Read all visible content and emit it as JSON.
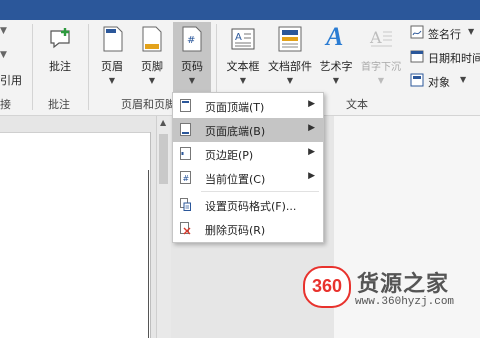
{
  "ribbon": {
    "edge_label": "引用",
    "comment_label": "批注",
    "header_label": "页眉",
    "footer_label": "页脚",
    "page_number_label": "页码",
    "textbox_label": "文本框",
    "quickparts_label": "文档部件",
    "wordart_label": "艺术字",
    "dropcap_label": "首字下沉",
    "signature_label": "签名行",
    "datetime_label": "日期和时间",
    "object_label": "对象",
    "group_comments": "批注",
    "group_headerfooter": "页眉和页脚",
    "group_text": "文本",
    "group_edge": "接"
  },
  "menu": {
    "items": [
      {
        "label": "页面顶端(T)",
        "icon": "page-top-icon"
      },
      {
        "label": "页面底端(B)",
        "icon": "page-bottom-icon"
      },
      {
        "label": "页边距(P)",
        "icon": "page-margins-icon"
      },
      {
        "label": "当前位置(C)",
        "icon": "current-position-icon"
      },
      {
        "label": "设置页码格式(F)...",
        "icon": "format-page-number-icon"
      },
      {
        "label": "删除页码(R)",
        "icon": "remove-page-number-icon"
      }
    ]
  },
  "watermark": {
    "logo": "360",
    "brand": "货源之家",
    "url": "www.360hyzj.com"
  },
  "colors": {
    "accent": "#2b579a",
    "logo_red": "#e8322d",
    "highlight": "#c5c5c5"
  }
}
